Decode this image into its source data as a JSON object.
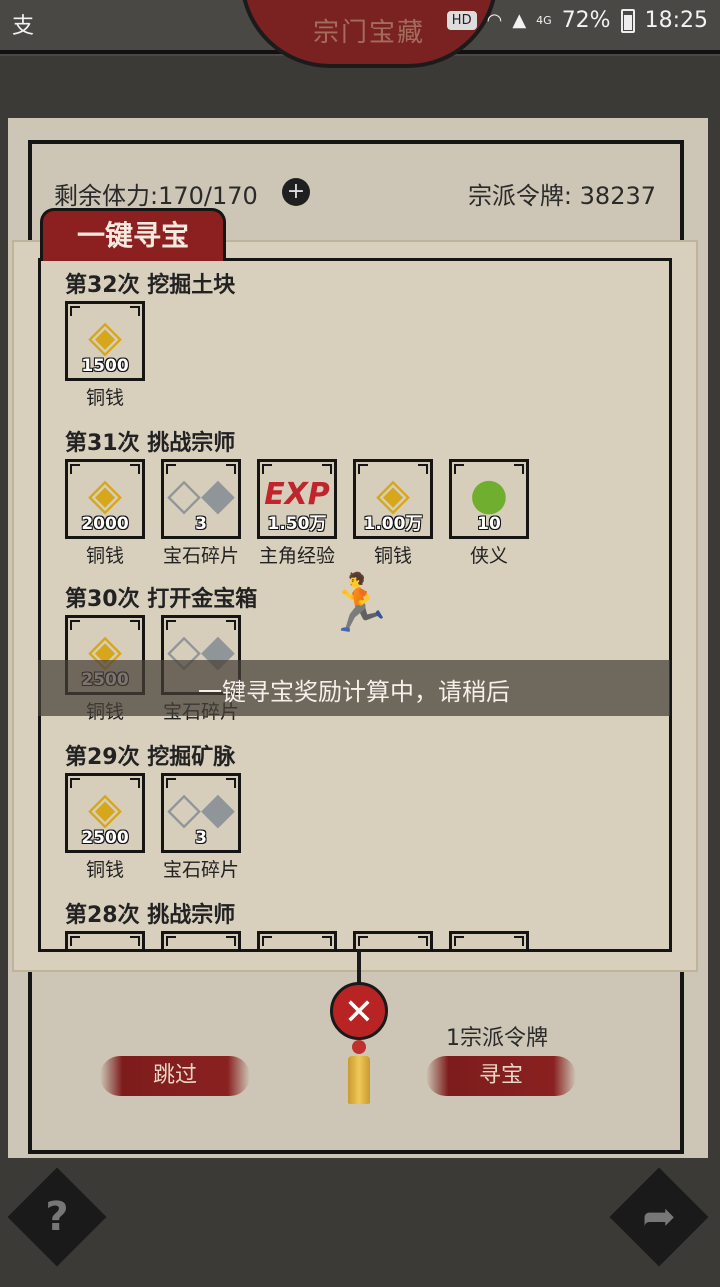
{
  "status_bar": {
    "left_icon": "支",
    "hd": "HD",
    "network": "4G",
    "battery_percent": "72%",
    "time": "18:25"
  },
  "header": {
    "title": "宗门宝藏"
  },
  "panel": {
    "stamina": "剩余体力:170/170",
    "token_count": "宗派令牌: 38237",
    "cost": "1宗派令牌",
    "skip_label": "跳过",
    "seek_label": "寻宝"
  },
  "popup": {
    "tab_title": "一键寻宝",
    "rounds": [
      {
        "title": "第32次 挖掘土块",
        "items": [
          {
            "icon": "coin-icon",
            "count": "1500",
            "name": "铜钱"
          }
        ]
      },
      {
        "title": "第31次 挑战宗师",
        "items": [
          {
            "icon": "coin-icon",
            "count": "2000",
            "name": "铜钱"
          },
          {
            "icon": "gem-shard-icon",
            "count": "3",
            "name": "宝石碎片"
          },
          {
            "icon": "exp-icon",
            "count": "1.50万",
            "name": "主角经验"
          },
          {
            "icon": "coin-icon",
            "count": "1.00万",
            "name": "铜钱"
          },
          {
            "icon": "pouch-icon",
            "count": "10",
            "name": "侠义"
          }
        ]
      },
      {
        "title": "第30次 打开金宝箱",
        "items": [
          {
            "icon": "coin-icon",
            "count": "2500",
            "name": "铜钱"
          },
          {
            "icon": "gem-shard-icon",
            "count": "",
            "name": "宝石碎片"
          }
        ]
      },
      {
        "title": "第29次 挖掘矿脉",
        "items": [
          {
            "icon": "coin-icon",
            "count": "2500",
            "name": "铜钱"
          },
          {
            "icon": "gem-shard-icon",
            "count": "3",
            "name": "宝石碎片"
          }
        ]
      },
      {
        "title": "第28次 挑战宗师",
        "items": [
          {
            "icon": "coin-icon",
            "count": "",
            "name": ""
          },
          {
            "icon": "ore-icon",
            "count": "",
            "name": ""
          },
          {
            "icon": "gem-shard-icon",
            "count": "",
            "name": ""
          },
          {
            "icon": "coin-icon",
            "count": "",
            "name": ""
          },
          {
            "icon": "coin-icon",
            "count": "",
            "name": ""
          }
        ]
      }
    ],
    "loading_message": "一键寻宝奖励计算中，请稍后"
  },
  "buttons": {
    "help": "?",
    "share": "➦",
    "close": "✕"
  }
}
